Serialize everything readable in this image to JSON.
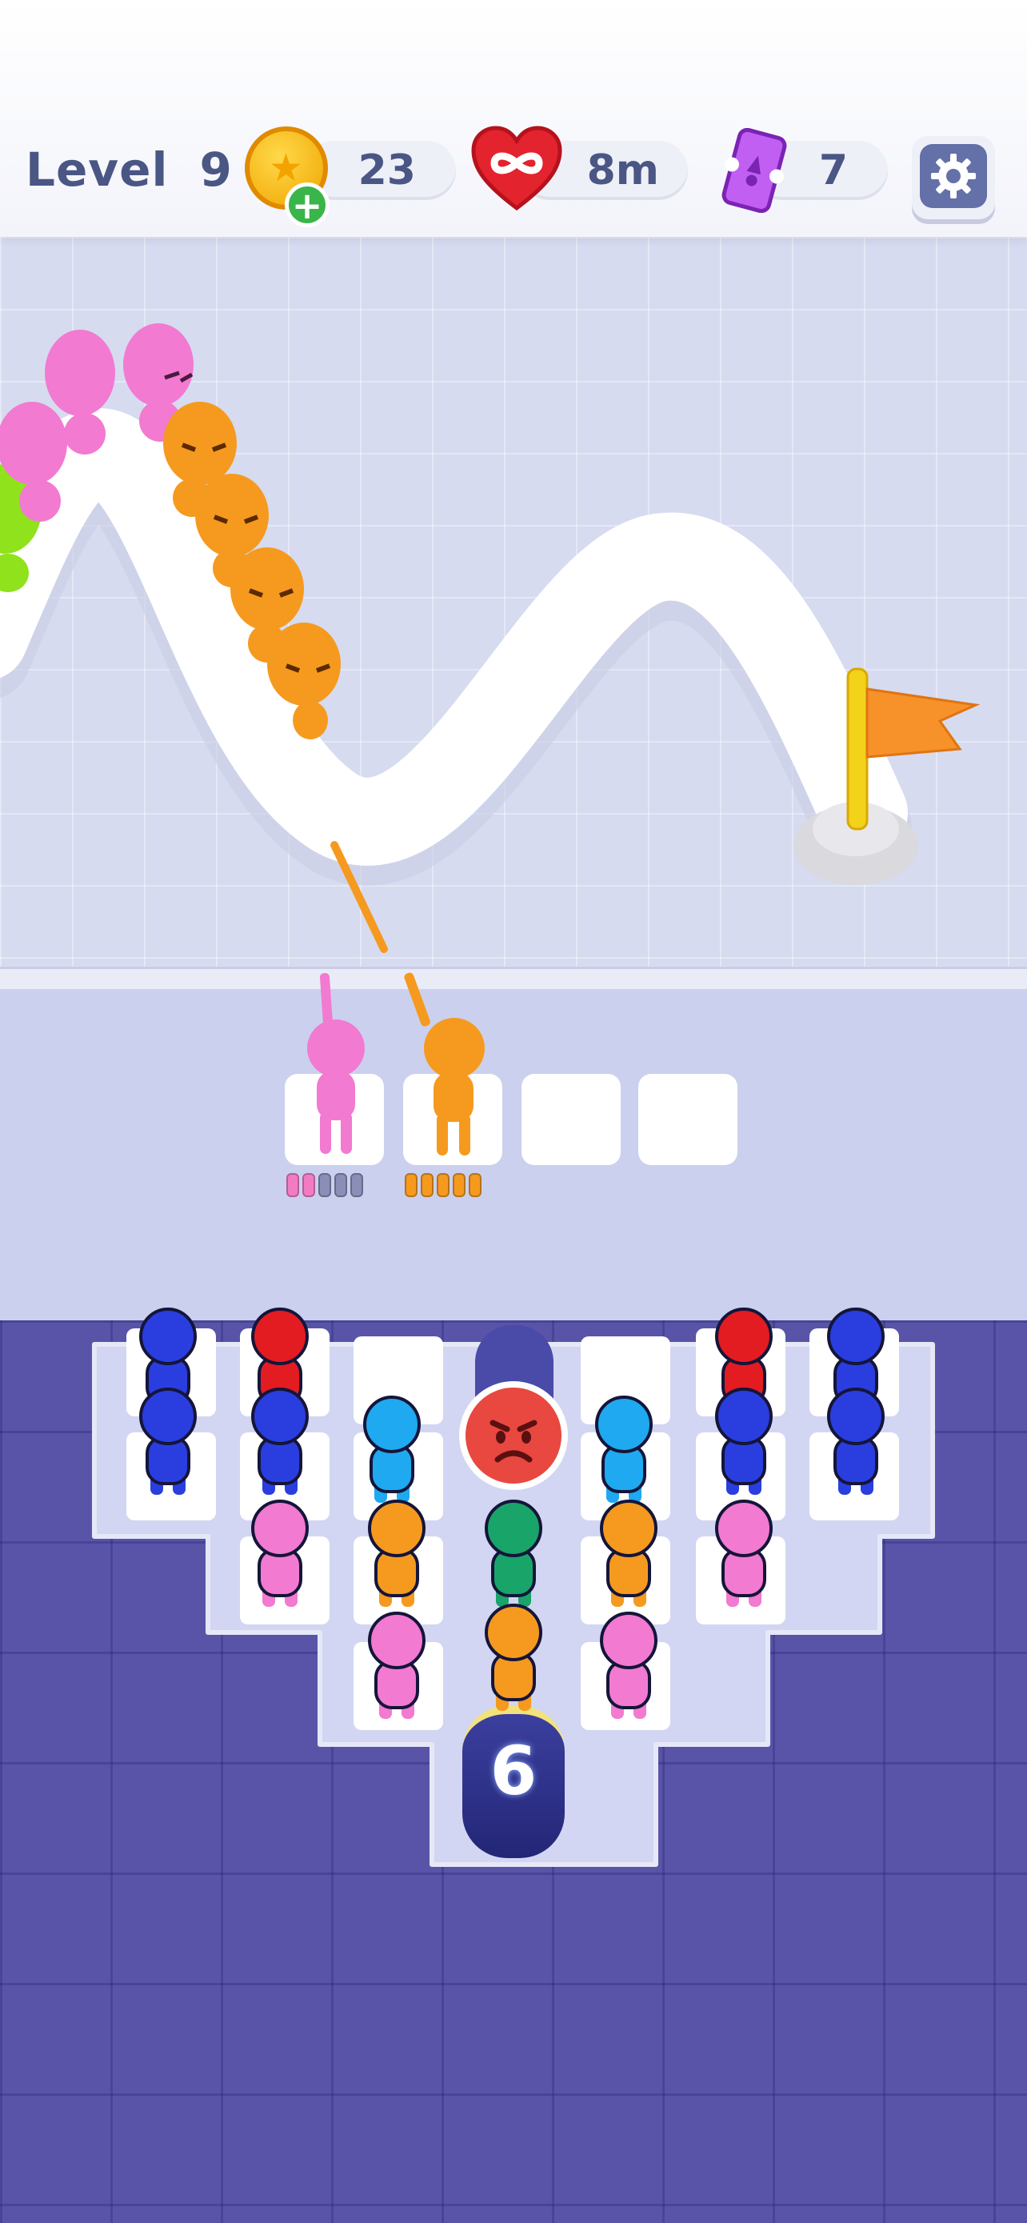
{
  "hud": {
    "level_label": "Level",
    "level_number": "9",
    "coins": "23",
    "lives_timer": "8m",
    "tickets": "7",
    "icons": [
      "coin-icon",
      "plus-icon",
      "infinity-heart-icon",
      "ticket-icon",
      "gear-icon"
    ]
  },
  "board": {
    "holder_count_label": "6",
    "shooter_slots": [
      {
        "color": "#f17cc4",
        "ammo_colors": [
          "#f17cc4",
          "#f17cc4",
          "#8a8fb8",
          "#8a8fb8",
          "#8a8fb8"
        ]
      },
      {
        "color": "#f59a1f",
        "ammo_colors": [
          "#f59a1f",
          "#f59a1f",
          "#f59a1f",
          "#f59a1f",
          "#f59a1f"
        ]
      },
      {
        "color": null
      },
      {
        "color": null
      }
    ]
  },
  "colors": {
    "pink": "#f27ad0",
    "orange": "#f59a1f",
    "blue": "#2a3ee0",
    "red": "#e31c22",
    "cyan": "#1fa9f0",
    "green": "#19a46a",
    "lime": "#8fe21c",
    "flag": "#f7922a",
    "pole": "#f3d21a"
  }
}
